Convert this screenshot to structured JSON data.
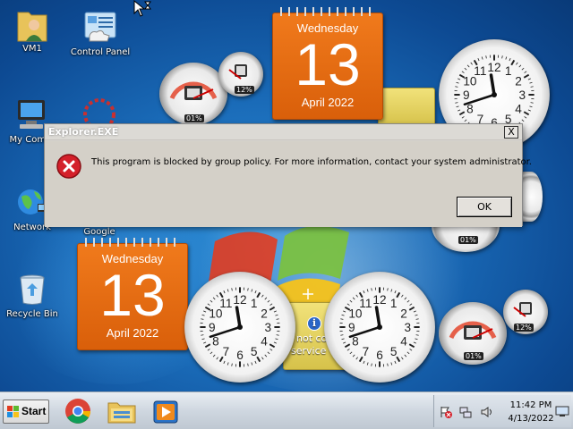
{
  "desktop_icons": [
    {
      "label": "VM1",
      "icon": "user-folder-icon"
    },
    {
      "label": "Control Panel",
      "icon": "control-panel-icon"
    },
    {
      "label": "My Comp",
      "icon": "computer-icon"
    },
    {
      "label": "Network",
      "icon": "network-globe-icon"
    },
    {
      "label": "Google",
      "icon": "google-icon"
    },
    {
      "label": "Recycle Bin",
      "icon": "recycle-bin-icon"
    }
  ],
  "calendar_gadgets": [
    {
      "weekday": "Wednesday",
      "day": "13",
      "month_year": "April 2022"
    },
    {
      "weekday": "Wednesday",
      "day": "13",
      "month_year": "April 2022"
    }
  ],
  "meter_gadgets": [
    {
      "cpu": "01%",
      "ram": "12%"
    },
    {
      "cpu": "01%",
      "ram": "12%"
    }
  ],
  "clock_time": {
    "hour": 11,
    "minute": 42
  },
  "feed_gadget": {
    "text_line1": "not connect",
    "text_line2": "service",
    "icon": "info-icon"
  },
  "dialog": {
    "title": "Explorer.EXE",
    "close_label": "X",
    "message": "This program is blocked by group policy. For more information, contact your system administrator.",
    "ok_label": "OK",
    "icon": "error-icon"
  },
  "taskbar": {
    "start_label": "Start",
    "pinned": [
      "chrome-icon",
      "file-explorer-icon",
      "media-player-icon"
    ],
    "tray_icons": [
      "action-center-flag-icon",
      "network-icon",
      "volume-icon"
    ],
    "time": "11:42 PM",
    "date": "4/13/2022"
  },
  "colors": {
    "desktop_blue": "#1a6bb8",
    "calendar_orange": "#e8690f",
    "error_red": "#d4202a"
  }
}
